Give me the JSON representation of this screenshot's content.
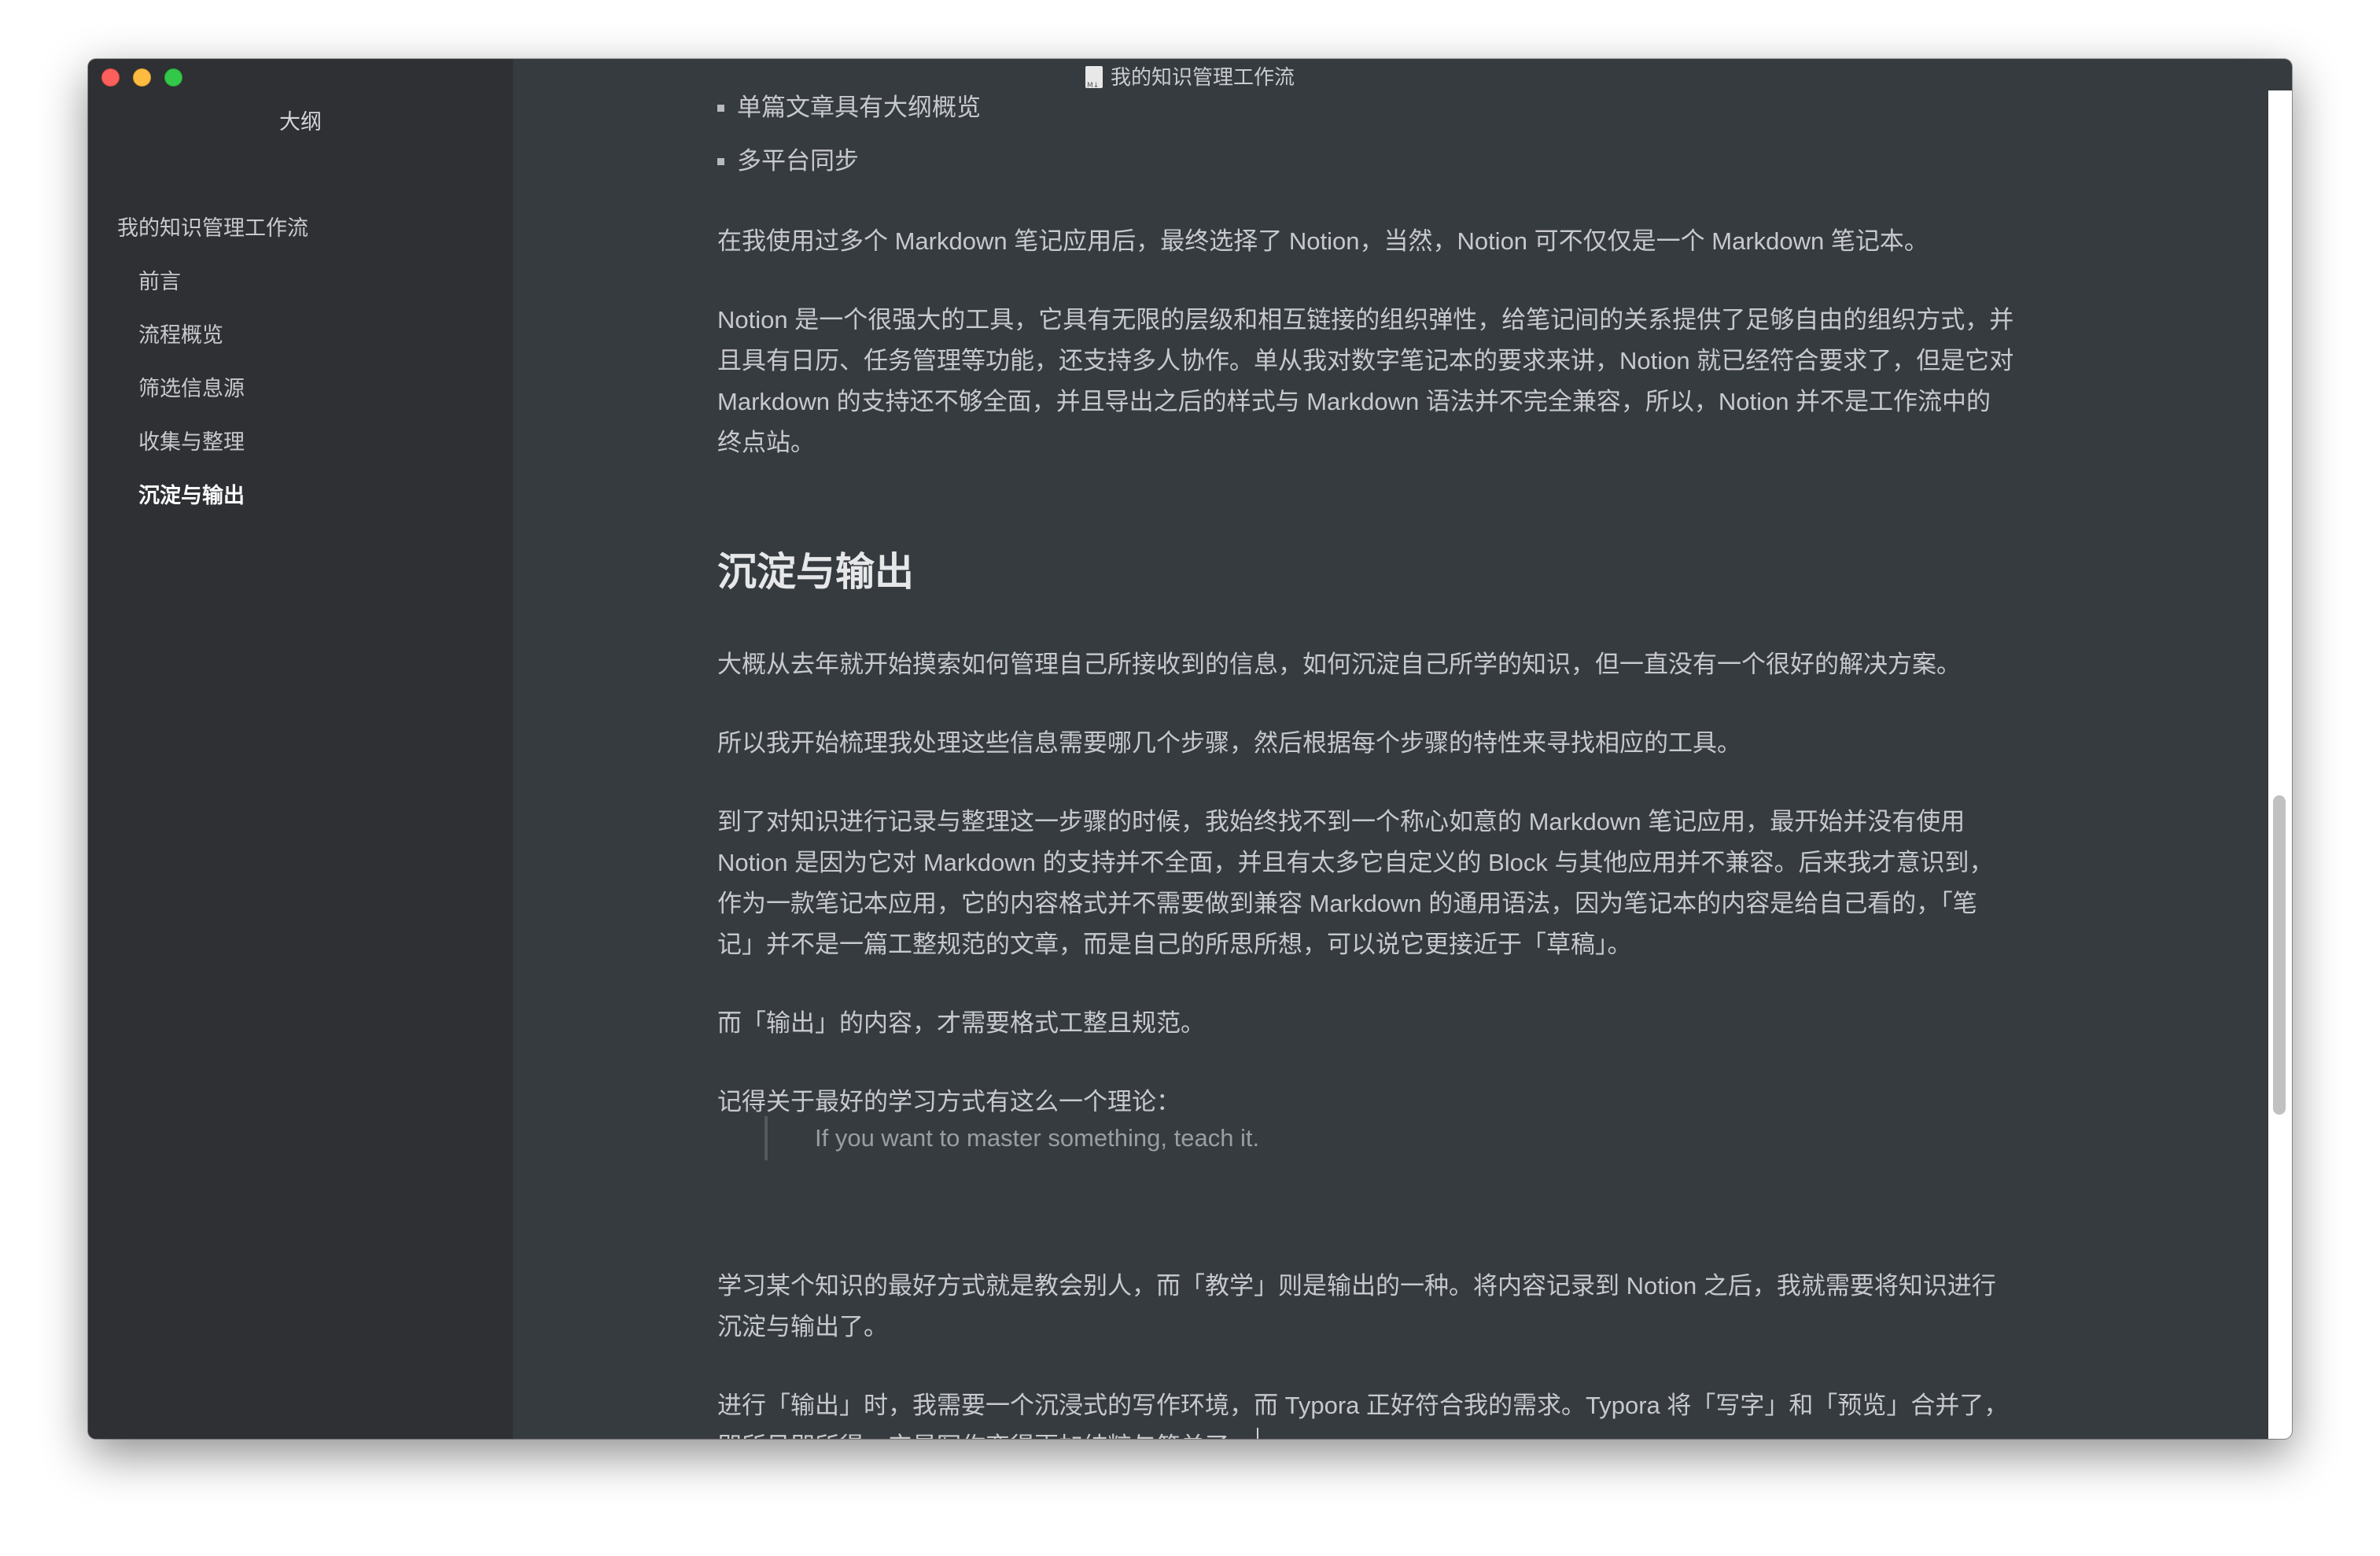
{
  "window": {
    "title": "我的知识管理工作流",
    "controls": {
      "close": "close-button",
      "minimize": "minimize-button",
      "zoom": "zoom-button"
    }
  },
  "sidebar": {
    "title": "大纲",
    "items": [
      {
        "label": "我的知识管理工作流",
        "level": 1,
        "active": false
      },
      {
        "label": "前言",
        "level": 2,
        "active": false
      },
      {
        "label": "流程概览",
        "level": 2,
        "active": false
      },
      {
        "label": "筛选信息源",
        "level": 2,
        "active": false
      },
      {
        "label": "收集与整理",
        "level": 2,
        "active": false
      },
      {
        "label": "沉淀与输出",
        "level": 2,
        "active": true
      }
    ]
  },
  "content": {
    "bullets": [
      "单篇文章具有大纲概览",
      "多平台同步"
    ],
    "p1": "在我使用过多个 Markdown 笔记应用后，最终选择了 Notion，当然，Notion 可不仅仅是一个 Markdown 笔记本。",
    "p2": [
      "Notion 是一个很强大的工具，它具有无限的层级和相互链接的组织弹性，给笔记间的关系提供了足够自由的组织方式，并",
      "且具有日历、任务管理等功能，还支持多人协作。单从我对数字笔记本的要求来讲，Notion 就已经符合要求了，但是它对",
      "Markdown 的支持还不够全面，并且导出之后的样式与 Markdown 语法并不完全兼容，所以，Notion 并不是工作流中的",
      "终点站。"
    ],
    "heading": "沉淀与输出",
    "p3": "大概从去年就开始摸索如何管理自己所接收到的信息，如何沉淀自己所学的知识，但一直没有一个很好的解决方案。",
    "p4": "所以我开始梳理我处理这些信息需要哪几个步骤，然后根据每个步骤的特性来寻找相应的工具。",
    "p5": [
      "到了对知识进行记录与整理这一步骤的时候，我始终找不到一个称心如意的 Markdown 笔记应用，最开始并没有使用",
      "Notion 是因为它对 Markdown 的支持并不全面，并且有太多它自定义的 Block 与其他应用并不兼容。后来我才意识到，",
      "作为一款笔记本应用，它的内容格式并不需要做到兼容 Markdown 的通用语法，因为笔记本的内容是给自己看的，「笔",
      "记」并不是一篇工整规范的文章，而是自己的所思所想，可以说它更接近于「草稿」。"
    ],
    "p6": "而「输出」的内容，才需要格式工整且规范。",
    "p7": "记得关于最好的学习方式有这么一个理论：",
    "quote": "If you want to master something, teach it.",
    "p8": [
      "学习某个知识的最好方式就是教会别人，而「教学」则是输出的一种。将内容记录到 Notion 之后，我就需要将知识进行",
      "沉淀与输出了。"
    ],
    "p9": [
      "进行「输出」时，我需要一个沉浸式的写作环境，而 Typora 正好符合我的需求。Typora 将「写字」和「预览」合并了，",
      "即所见即所得，它是写作变得更加纯粹与简单了。"
    ]
  },
  "colors": {
    "editor_bg": "#363b40",
    "sidebar_bg": "#2e3033",
    "text": "#c7c9cc",
    "heading": "#e6e7e9",
    "quote": "#9a9ea3"
  },
  "scroll": {
    "position_fraction": 0.53
  }
}
